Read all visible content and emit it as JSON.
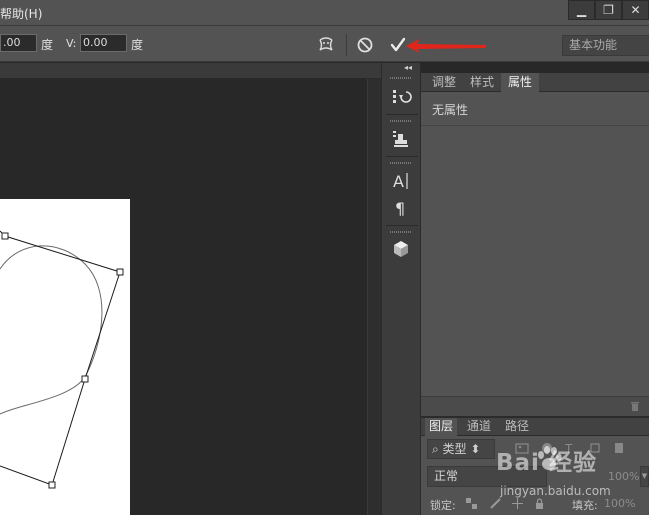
{
  "menu": {
    "help": "帮助(H)"
  },
  "window_controls": {
    "minimize": "▁",
    "restore": "❐",
    "close": "✕"
  },
  "options_bar": {
    "h_value": ".00",
    "h_unit": "度",
    "v_label": "V:",
    "v_value": "0.00",
    "v_unit": "度",
    "workspace": "基本功能"
  },
  "dock": {
    "collapse_glyph": "◂◂"
  },
  "properties_panel": {
    "tabs": [
      "调整",
      "样式",
      "属性"
    ],
    "active_tab": "属性",
    "empty_text": "无属性"
  },
  "layers_panel": {
    "tabs": [
      "图层",
      "通道",
      "路径"
    ],
    "filter_label": "类型",
    "blend_mode": "正常",
    "opacity": "100%",
    "lock_label": "锁定:",
    "fill_label": "填充:",
    "fill_value": "100%"
  },
  "watermark": {
    "brand": "Bai  经验",
    "url": "jingyan.baidu.com"
  },
  "colors": {
    "annotation_arrow": "#e0251b",
    "canvas": "#ffffff",
    "panel": "#535353"
  }
}
